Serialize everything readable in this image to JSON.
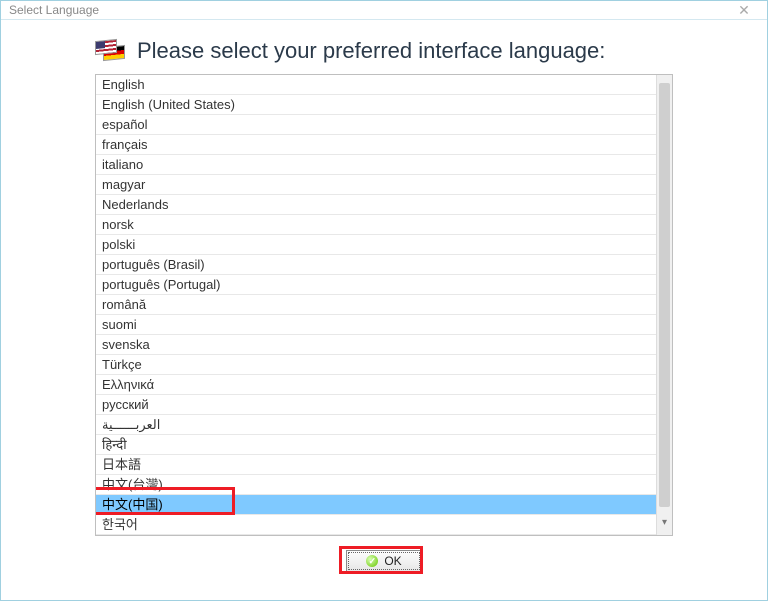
{
  "window": {
    "title": "Select Language"
  },
  "header": {
    "heading": "Please select your preferred interface language:"
  },
  "languages": [
    {
      "label": "English",
      "selected": false
    },
    {
      "label": "English (United States)",
      "selected": false
    },
    {
      "label": "español",
      "selected": false
    },
    {
      "label": "français",
      "selected": false
    },
    {
      "label": "italiano",
      "selected": false
    },
    {
      "label": "magyar",
      "selected": false
    },
    {
      "label": "Nederlands",
      "selected": false
    },
    {
      "label": "norsk",
      "selected": false
    },
    {
      "label": "polski",
      "selected": false
    },
    {
      "label": "português (Brasil)",
      "selected": false
    },
    {
      "label": "português (Portugal)",
      "selected": false
    },
    {
      "label": "română",
      "selected": false
    },
    {
      "label": "suomi",
      "selected": false
    },
    {
      "label": "svenska",
      "selected": false
    },
    {
      "label": "Türkçe",
      "selected": false
    },
    {
      "label": "Ελληνικά",
      "selected": false
    },
    {
      "label": "русский",
      "selected": false
    },
    {
      "label": "العربــــــية",
      "selected": false
    },
    {
      "label": "हिन्दी",
      "selected": false
    },
    {
      "label": "日本語",
      "selected": false
    },
    {
      "label": "中文(台灣)",
      "selected": false
    },
    {
      "label": "中文(中国)",
      "selected": true
    },
    {
      "label": "한국어",
      "selected": false
    }
  ],
  "buttons": {
    "ok": "OK"
  },
  "highlights": {
    "selected_item": true,
    "ok_button": true
  }
}
